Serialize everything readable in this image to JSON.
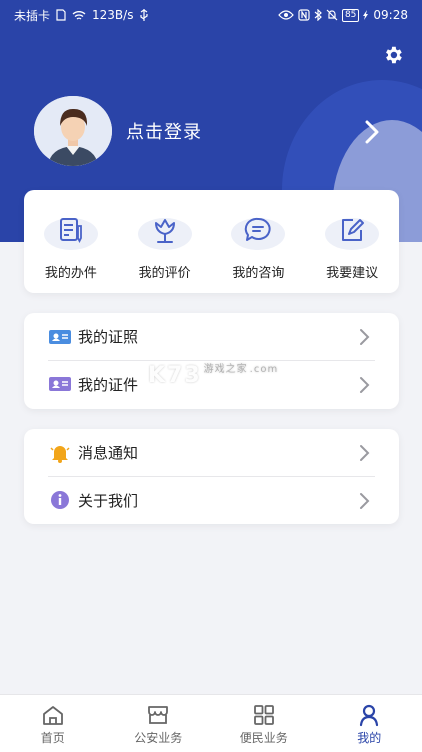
{
  "status_bar": {
    "carrier": "未插卡",
    "speed": "123B/s",
    "battery": "85",
    "time": "09:28"
  },
  "profile": {
    "login_label": "点击登录"
  },
  "quick_actions": [
    {
      "label": "我的办件",
      "icon": "document-pen-icon"
    },
    {
      "label": "我的评价",
      "icon": "flower-icon"
    },
    {
      "label": "我的咨询",
      "icon": "chat-bubble-icon"
    },
    {
      "label": "我要建议",
      "icon": "edit-icon"
    }
  ],
  "list1": [
    {
      "label": "我的证照",
      "icon": "id-card-icon"
    },
    {
      "label": "我的证件",
      "icon": "id-card-icon"
    }
  ],
  "list2": [
    {
      "label": "消息通知",
      "icon": "bell-icon"
    },
    {
      "label": "关于我们",
      "icon": "info-icon"
    }
  ],
  "watermark": {
    "brand": "K73",
    "sub": "游戏之家",
    "domain": ".com"
  },
  "tabs": [
    {
      "label": "首页",
      "icon": "home-icon"
    },
    {
      "label": "公安业务",
      "icon": "shop-icon"
    },
    {
      "label": "便民业务",
      "icon": "grid-icon"
    },
    {
      "label": "我的",
      "icon": "user-icon"
    }
  ],
  "colors": {
    "primary": "#2a44a8",
    "accent_icon": "#4a63c8",
    "bell": "#f2a51a",
    "info": "#8a77d8"
  }
}
